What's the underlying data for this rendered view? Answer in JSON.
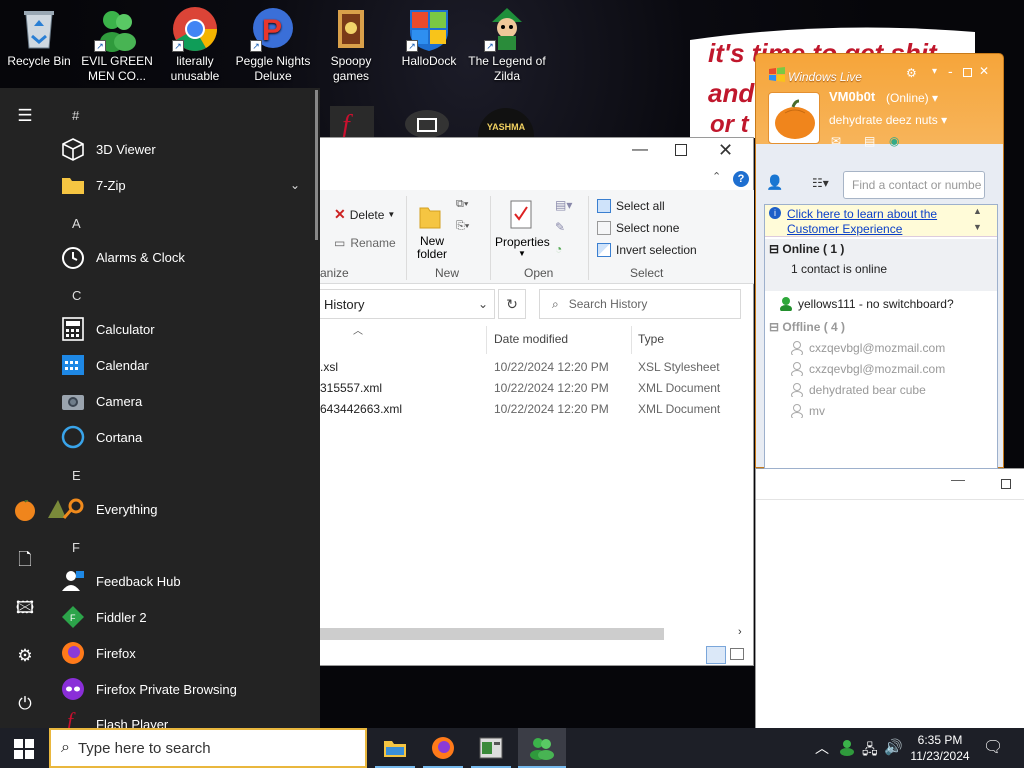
{
  "desktop": {
    "icons": [
      {
        "label": "Recycle Bin"
      },
      {
        "label": "EVIL GREEN MEN CO..."
      },
      {
        "label": "literally unusable"
      },
      {
        "label": "Peggle Nights Deluxe"
      },
      {
        "label": "Spoopy games"
      },
      {
        "label": "HalloDock"
      },
      {
        "label": "The Legend of Zilda"
      }
    ],
    "wallpaper_text": "it's time to get shit and or t",
    "partial_icon_label": "YASHMA"
  },
  "start_menu": {
    "letters": {
      "hash": "#",
      "a": "A",
      "c": "C",
      "e": "E",
      "f": "F"
    },
    "apps": [
      {
        "label": "3D Viewer",
        "icon": "cube-icon"
      },
      {
        "label": "7-Zip",
        "icon": "folder-icon"
      },
      {
        "label": "Alarms & Clock",
        "icon": "clock-icon"
      },
      {
        "label": "Calculator",
        "icon": "calculator-icon"
      },
      {
        "label": "Calendar",
        "icon": "calendar-icon"
      },
      {
        "label": "Camera",
        "icon": "camera-icon"
      },
      {
        "label": "Cortana",
        "icon": "cortana-icon"
      },
      {
        "label": "Everything",
        "icon": "everything-icon"
      },
      {
        "label": "Feedback Hub",
        "icon": "feedback-icon"
      },
      {
        "label": "Fiddler 2",
        "icon": "fiddler-icon"
      },
      {
        "label": "Firefox",
        "icon": "firefox-icon"
      },
      {
        "label": "Firefox Private Browsing",
        "icon": "firefox-private-icon"
      },
      {
        "label": "Flash Player",
        "icon": "flash-icon"
      }
    ]
  },
  "explorer": {
    "ribbon": {
      "delete": "Delete",
      "rename": "Rename",
      "organize": "anize",
      "new_folder_1": "New",
      "new_folder_2": "folder",
      "new_group": "New",
      "properties": "Properties",
      "open_group": "Open",
      "select_all": "Select all",
      "select_none": "Select none",
      "invert_selection": "Invert selection",
      "select_group": "Select"
    },
    "address": "History",
    "search_placeholder": "Search History",
    "columns": {
      "date": "Date modified",
      "type": "Type"
    },
    "files": [
      {
        "name": ".xsl",
        "date": "10/22/2024 12:20 PM",
        "type": "XSL Stylesheet"
      },
      {
        "name": "315557.xml",
        "date": "10/22/2024 12:20 PM",
        "type": "XML Document"
      },
      {
        "name": "643442663.xml",
        "date": "10/22/2024 12:20 PM",
        "type": "XML Document"
      }
    ]
  },
  "messenger": {
    "title": "Windows Live",
    "user_name": "VM0b0t",
    "status": "(Online)",
    "personal_message": "dehydrate deez nuts",
    "find_placeholder": "Find a contact or numbe",
    "notice": "Click here to learn about the Customer Experience",
    "online_header": "Online ( 1 )",
    "online_sub": "1 contact is online",
    "online_contacts": [
      {
        "name": "yellows111 - no switchboard?"
      }
    ],
    "offline_header": "Offline ( 4 )",
    "offline_contacts": [
      {
        "name": "cxzqevbgl@mozmail.com"
      },
      {
        "name": "cxzqevbgl@mozmail.com"
      },
      {
        "name": "dehydrated bear cube"
      },
      {
        "name": "mv"
      }
    ]
  },
  "taskbar": {
    "search_placeholder": "Type here to search",
    "time": "6:35 PM",
    "date": "11/23/2024"
  },
  "colors": {
    "accent": "#0078d7",
    "msn_orange": "#f6a53a",
    "start_bg": "#232323",
    "taskbar": "#1d1f27"
  }
}
